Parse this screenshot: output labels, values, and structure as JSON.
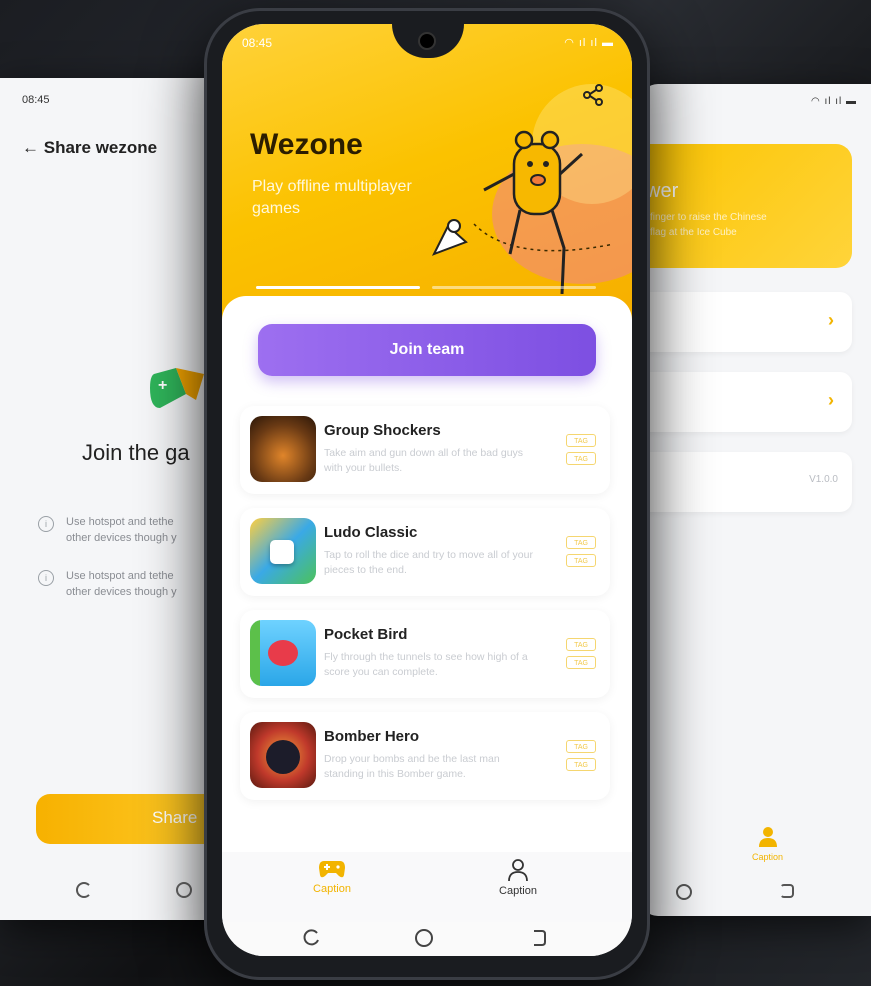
{
  "left_screen": {
    "status_time": "08:45",
    "back_title": "Share wezone",
    "join_heading": "Join the ga",
    "hints": [
      {
        "line1": "Use hotspot and tethe",
        "line2": "other devices though y"
      },
      {
        "line1": "Use hotspot and tethe",
        "line2": "other devices though y"
      }
    ],
    "share_button": "Share"
  },
  "right_screen": {
    "card_title": "wer",
    "card_subtitle_1": "finger to raise the Chinese",
    "card_subtitle_2": "flag at the Ice Cube",
    "version": "V1.0.0",
    "tab_label": "Caption"
  },
  "status": {
    "time": "08:45"
  },
  "hero": {
    "title": "Wezone",
    "subtitle": "Play offline multiplayer games"
  },
  "join_button": "Join team",
  "games": [
    {
      "name": "Group Shockers",
      "desc": "Take aim and gun down all of the bad guys with your bullets.",
      "tags": [
        "TAG",
        "TAG"
      ]
    },
    {
      "name": "Ludo Classic",
      "desc": "Tap to roll the dice and try to move all of your pieces to the end.",
      "tags": [
        "TAG",
        "TAG"
      ]
    },
    {
      "name": "Pocket Bird",
      "desc": "Fly through the tunnels to see how high of a score you can complete.",
      "tags": [
        "TAG",
        "TAG"
      ]
    },
    {
      "name": "Bomber Hero",
      "desc": "Drop your bombs and be the last man standing in this Bomber game.",
      "tags": [
        "TAG",
        "TAG"
      ]
    }
  ],
  "tabs": [
    {
      "label": "Caption",
      "icon": "gamepad-icon",
      "active": true
    },
    {
      "label": "Caption",
      "icon": "person-icon",
      "active": false
    }
  ],
  "colors": {
    "accent": "#fbc200",
    "purple": "#8a5ce8"
  }
}
